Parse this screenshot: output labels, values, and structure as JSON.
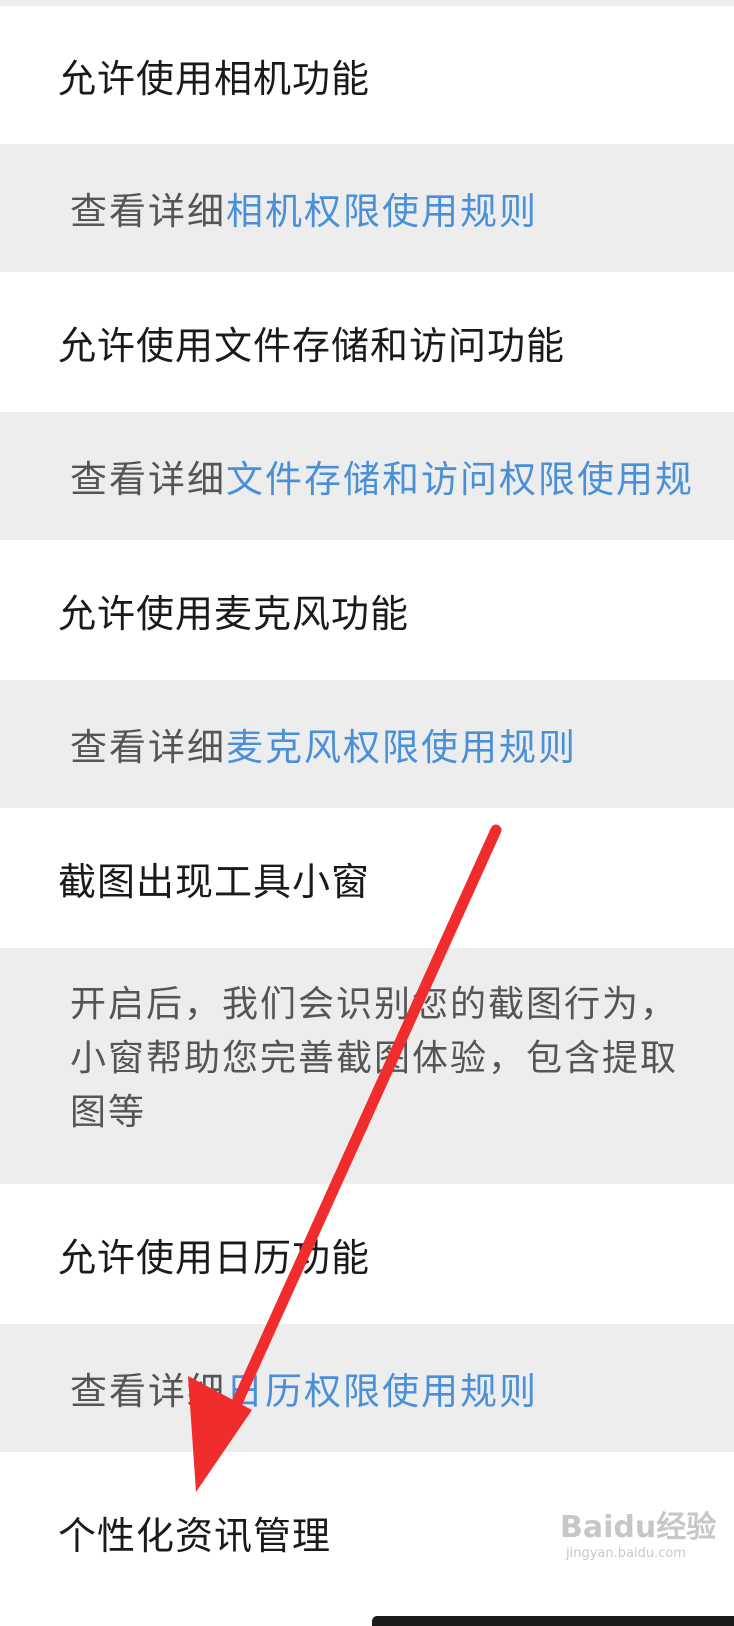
{
  "items": [
    {
      "title": "允许使用相机功能",
      "desc_prefix": "查看详细",
      "desc_link": "相机权限使用规则"
    },
    {
      "title": "允许使用文件存储和访问功能",
      "desc_prefix": "查看详细",
      "desc_link": "文件存储和访问权限使用规"
    },
    {
      "title": "允许使用麦克风功能",
      "desc_prefix": "查看详细",
      "desc_link": "麦克风权限使用规则"
    },
    {
      "title": "截图出现工具小窗",
      "desc_lines": [
        "开启后，我们会识别您的截图行为，",
        "小窗帮助您完善截图体验，包含提取",
        "图等"
      ]
    },
    {
      "title": "允许使用日历功能",
      "desc_prefix": "查看详细",
      "desc_link": "日历权限使用规则"
    },
    {
      "title": "个性化资讯管理"
    }
  ],
  "watermark": {
    "logo": "Baidu经验",
    "url": "jingyan.baidu.com"
  },
  "colors": {
    "link": "#4a90d9",
    "desc_bg": "#ededed",
    "arrow": "#f02c2c"
  }
}
